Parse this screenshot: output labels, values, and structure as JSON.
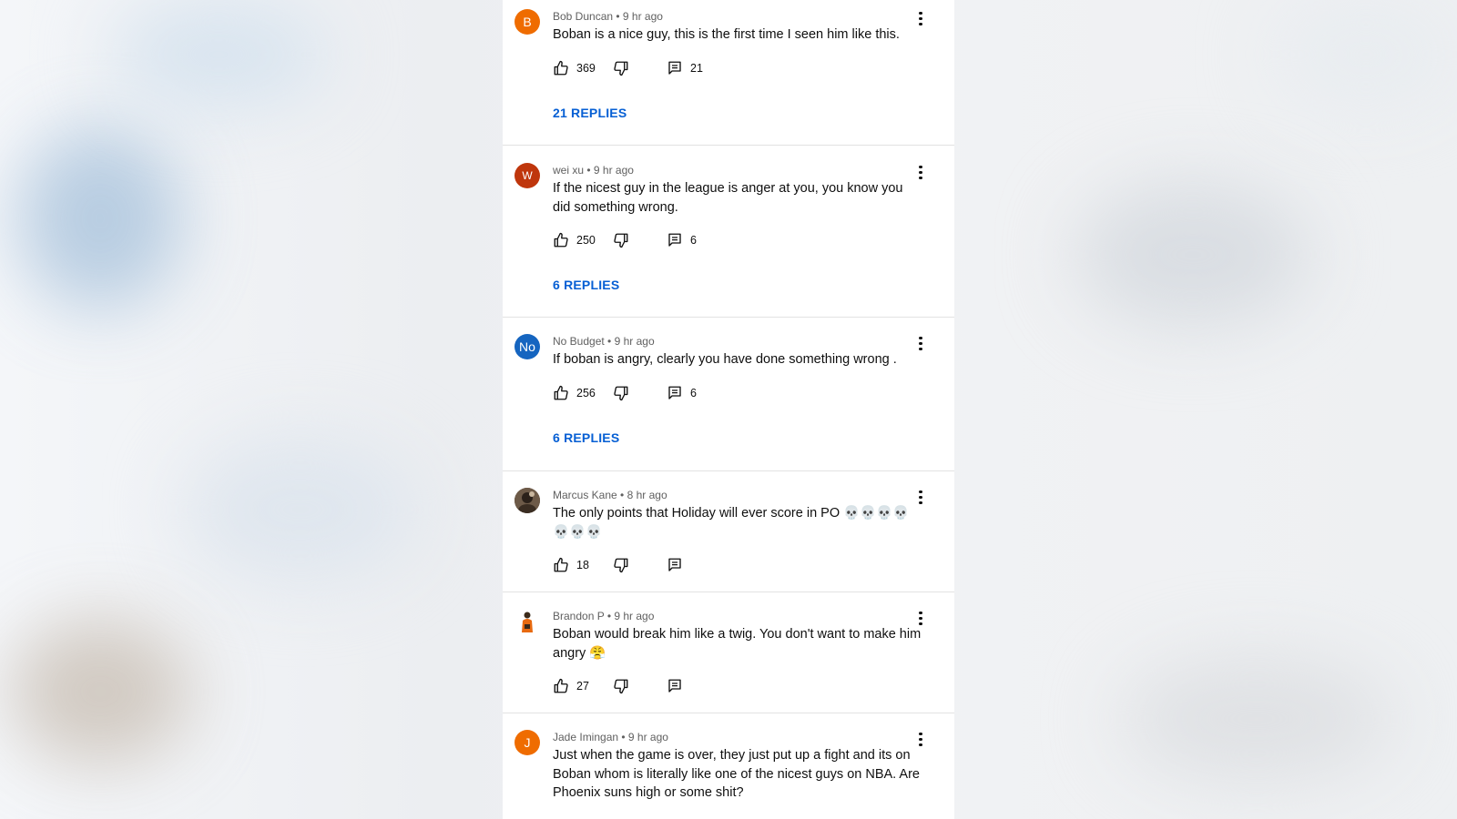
{
  "colors": {
    "link": "#065fd4",
    "text": "#0f0f0f",
    "meta": "#606060"
  },
  "comments": [
    {
      "author": "Bob Duncan",
      "time": "9 hr ago",
      "avatar_letter": "B",
      "avatar_color": "#ef6c00",
      "text": "Boban is a nice guy, this is the first time I seen him like this.",
      "likes": "369",
      "reply_count": "21",
      "replies_label": "21 REPLIES"
    },
    {
      "author": "wei xu",
      "time": "9 hr ago",
      "avatar_letter": "W",
      "avatar_color": "#bf360c",
      "text": "If the nicest guy in the league is anger at you, you know you did something wrong.",
      "likes": "250",
      "reply_count": "6",
      "replies_label": "6 REPLIES"
    },
    {
      "author": "No Budget",
      "time": "9 hr ago",
      "avatar_letter": "No",
      "avatar_color": "#1565c0",
      "text": "If boban is angry, clearly you have done something wrong .",
      "likes": "256",
      "reply_count": "6",
      "replies_label": "6 REPLIES"
    },
    {
      "author": "Marcus Kane",
      "time": "8 hr ago",
      "avatar_letter": "",
      "avatar_color": "#5d4a3a",
      "text": "The only points that Holiday will ever score in PO 💀💀💀💀💀💀💀",
      "likes": "18",
      "reply_count": "",
      "replies_label": ""
    },
    {
      "author": "Brandon P",
      "time": "9 hr ago",
      "avatar_letter": "",
      "avatar_color": "#ffffff",
      "text": "Boban would break him like a twig. You don't want to make him angry 😤",
      "likes": "27",
      "reply_count": "",
      "replies_label": ""
    },
    {
      "author": "Jade Imingan",
      "time": "9 hr ago",
      "avatar_letter": "J",
      "avatar_color": "#ef6c00",
      "text": "Just when the game is over, they just put up a fight and its on Boban whom is literally like one of the nicest guys on NBA. Are Phoenix suns high or some shit?",
      "likes": "",
      "reply_count": "",
      "replies_label": ""
    }
  ]
}
